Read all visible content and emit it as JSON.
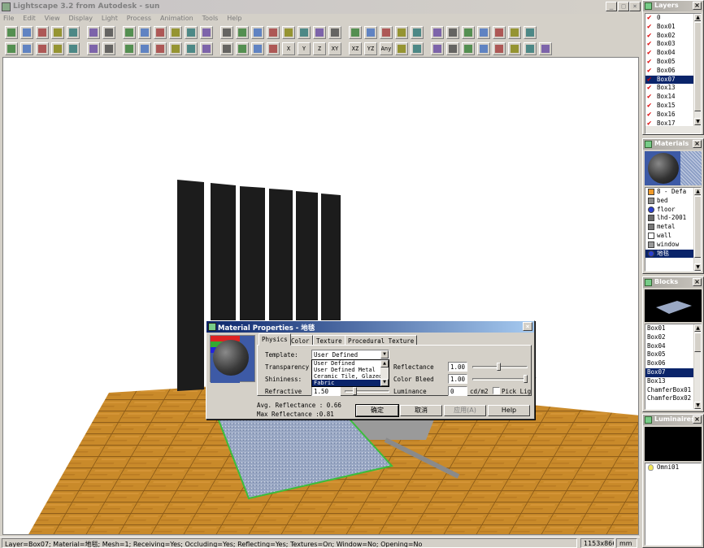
{
  "app": {
    "title": "Lightscape 3.2 from Autodesk - sun"
  },
  "menu": [
    "File",
    "Edit",
    "View",
    "Display",
    "Light",
    "Process",
    "Animation",
    "Tools",
    "Help"
  ],
  "window_controls": {
    "minimize": "_",
    "maximize": "□",
    "close": "×"
  },
  "panels": {
    "layers": {
      "title": "Layers",
      "items": [
        {
          "name": "0",
          "checked": true
        },
        {
          "name": "Box01",
          "checked": true
        },
        {
          "name": "Box02",
          "checked": true
        },
        {
          "name": "Box03",
          "checked": true
        },
        {
          "name": "Box04",
          "checked": true
        },
        {
          "name": "Box05",
          "checked": true
        },
        {
          "name": "Box06",
          "checked": true
        },
        {
          "name": "Box07",
          "checked": true,
          "selected": true
        },
        {
          "name": "Box13",
          "checked": true
        },
        {
          "name": "Box14",
          "checked": true
        },
        {
          "name": "Box15",
          "checked": true
        },
        {
          "name": "Box16",
          "checked": true
        },
        {
          "name": "Box17",
          "checked": true
        }
      ]
    },
    "materials": {
      "title": "Materials",
      "items": [
        {
          "name": "8 - Defa",
          "swatch": "#f09a2a"
        },
        {
          "name": "bed",
          "swatch": "#8c8c8c"
        },
        {
          "name": "floor",
          "swatch": "#2a3fd0",
          "icon": "globe"
        },
        {
          "name": "lhd-2001",
          "swatch": "#6c6c6c"
        },
        {
          "name": "metal",
          "swatch": "#777777"
        },
        {
          "name": "wall",
          "swatch": "#ffffff"
        },
        {
          "name": "window",
          "swatch": "#9a9a9a"
        },
        {
          "name": "地毯",
          "swatch": "#2a3fd0",
          "icon": "globe",
          "selected": true
        }
      ]
    },
    "blocks": {
      "title": "Blocks",
      "items": [
        {
          "name": "Box01"
        },
        {
          "name": "Box02"
        },
        {
          "name": "Box04"
        },
        {
          "name": "Box05"
        },
        {
          "name": "Box06"
        },
        {
          "name": "Box07",
          "selected": true
        },
        {
          "name": "Box13"
        },
        {
          "name": "ChamferBox01"
        },
        {
          "name": "ChamferBox02"
        }
      ]
    },
    "luminaires": {
      "title": "Luminaires",
      "items": [
        {
          "name": "Omni01"
        }
      ]
    }
  },
  "dialog": {
    "title": "Material Properties - 地毯",
    "tabs": [
      "Physics",
      "Color",
      "Texture",
      "Procedural Texture"
    ],
    "active_tab": "Physics",
    "template_label": "Template:",
    "template_value": "User Defined",
    "template_options": [
      "User Defined",
      "User Defined Metal",
      "Ceramic Tile, Glazed",
      "Fabric"
    ],
    "template_selected_option": "Fabric",
    "transparency_label": "Transparency",
    "shininess_label": "Shininess:",
    "refractive_label": "Refractive",
    "refractive_value": "1.50",
    "reflectance_label": "Reflectance",
    "reflectance_value": "1.00",
    "color_bleed_label": "Color Bleed",
    "color_bleed_value": "1.00",
    "luminance_label": "Luminance",
    "luminance_value": "0",
    "luminance_unit": "cd/m2",
    "pick_light_label": "Pick Lig",
    "avg_reflectance": "Avg. Reflectance : 0.66",
    "max_reflectance": "Max Reflectance :0.81",
    "buttons": {
      "ok": "确定",
      "cancel": "取消",
      "apply": "应用(A)",
      "help": "Help"
    }
  },
  "status": {
    "info": "Layer=Box07; Material=地毯; Mesh=1; Receiving=Yes; Occluding=Yes; Reflecting=Yes; Textures=On; Window=No; Opening=No",
    "resolution": "1153x866",
    "units": "mm"
  },
  "toolbar_icons": {
    "row1": [
      "new-icon",
      "open-icon",
      "save-icon",
      "undo-icon",
      "print-icon",
      "print-preview-icon",
      "help-context-icon",
      "select-view-icon",
      "view-front-icon",
      "view-back-icon",
      "view-left-icon",
      "view-right-icon",
      "view-top-icon",
      "zoom-extents-icon",
      "camera-icon",
      "walk-icon",
      "zoom-icon",
      "pan-icon",
      "fit-icon",
      "dolly-icon",
      "orbit-icon",
      "render-icon",
      "layers-icon",
      "materials-icon",
      "blocks-icon",
      "luminaires-icon",
      "display-mode-icon",
      "solution-icon",
      "process-icon",
      "shading-icon",
      "wireframe-icon",
      "globe-render-icon",
      "image-icon"
    ],
    "row2": [
      "pointer-icon",
      "select-arrow-icon",
      "select-region-icon",
      "select-object-icon",
      "select-block-icon",
      "select-layer-icon",
      "copy-icon",
      "paste-icon",
      "surface-select-icon",
      "block-select-icon",
      "layer-select-icon",
      "properties-icon",
      "material-pick-icon",
      "move-icon",
      "rotate-icon",
      "scale-icon",
      "rotate-3d-icon",
      "constrain-x-icon",
      "constrain-y-icon",
      "constrain-z-icon",
      "constrain-xy-icon",
      "constrain-xz-icon",
      "constrain-yz-icon",
      "constrain-any-icon",
      "light-icon",
      "sun-icon",
      "person-run-icon",
      "person-walk-icon",
      "person-stand-icon",
      "person-sit-icon",
      "list-icon",
      "globe-small-icon",
      "paint-icon",
      "brush-icon"
    ]
  },
  "constraint_labels": [
    "X",
    "Y",
    "Z",
    "XY",
    "XZ",
    "YZ",
    "Any"
  ]
}
